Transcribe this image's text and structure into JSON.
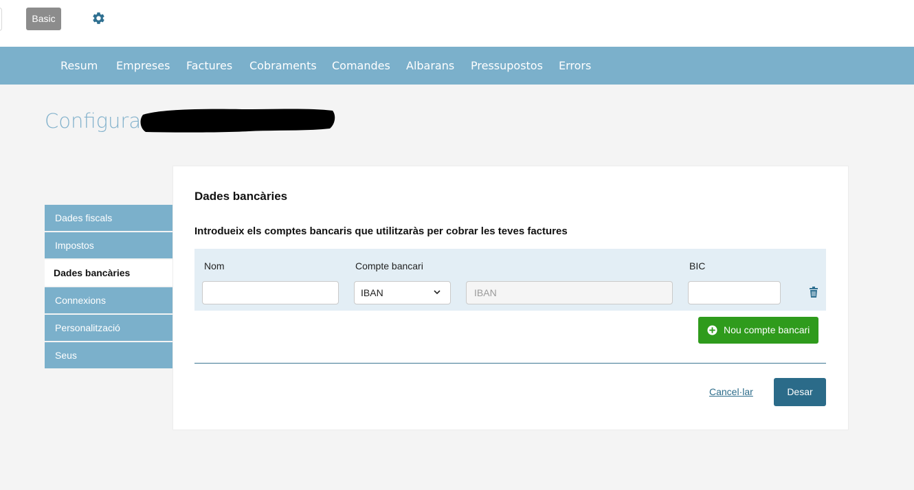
{
  "topbar": {
    "plan_badge": "Basic",
    "settings_icon": "gear-icon"
  },
  "nav": {
    "items": [
      {
        "label": "Resum"
      },
      {
        "label": "Empreses"
      },
      {
        "label": "Factures"
      },
      {
        "label": "Cobraments"
      },
      {
        "label": "Comandes"
      },
      {
        "label": "Albarans"
      },
      {
        "label": "Pressupostos"
      },
      {
        "label": "Errors"
      }
    ]
  },
  "page": {
    "title": "Configurar"
  },
  "sidebar": {
    "items": [
      {
        "label": "Dades fiscals"
      },
      {
        "label": "Impostos"
      },
      {
        "label": "Dades bancàries"
      },
      {
        "label": "Connexions"
      },
      {
        "label": "Personalització"
      },
      {
        "label": "Seus"
      }
    ],
    "active": "Dades bancàries"
  },
  "bank": {
    "title": "Dades bancàries",
    "subtitle": "Introdueix els comptes bancaris que utilitzaràs per cobrar les teves factures",
    "columns": {
      "name": "Nom",
      "account": "Compte bancari",
      "bic": "BIC"
    },
    "row": {
      "name_value": "",
      "account_type": "IBAN",
      "iban_placeholder": "IBAN",
      "iban_value": "",
      "bic_value": ""
    },
    "add_button": "Nou compte bancari"
  },
  "actions": {
    "cancel": "Cancel·lar",
    "save": "Desar"
  },
  "colors": {
    "nav_bg": "#7bb0cb",
    "add_button": "#2f9b1c",
    "save_button": "#2b6b89",
    "row_bg": "#e3eef5"
  }
}
